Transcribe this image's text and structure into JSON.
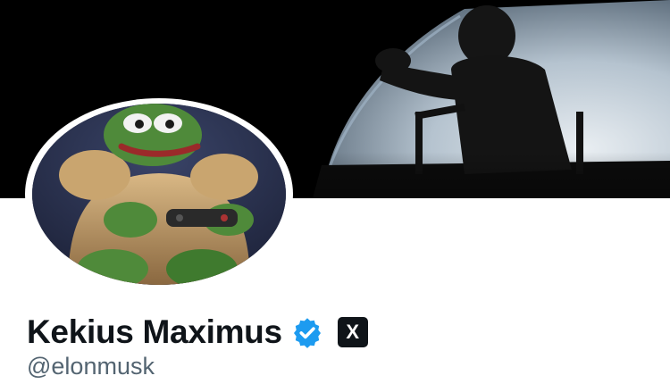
{
  "profile": {
    "display_name": "Kekius Maximus",
    "handle": "@elonmusk",
    "verified": true,
    "affiliation_badge": "X"
  },
  "banner": {
    "description_icon": "astronaut-on-earth-horizon-image"
  },
  "avatar": {
    "description_icon": "pepe-frog-armored-gamer-image"
  },
  "colors": {
    "verified_blue": "#1d9bf0",
    "name_text": "#0f1419",
    "handle_text": "#536471"
  }
}
